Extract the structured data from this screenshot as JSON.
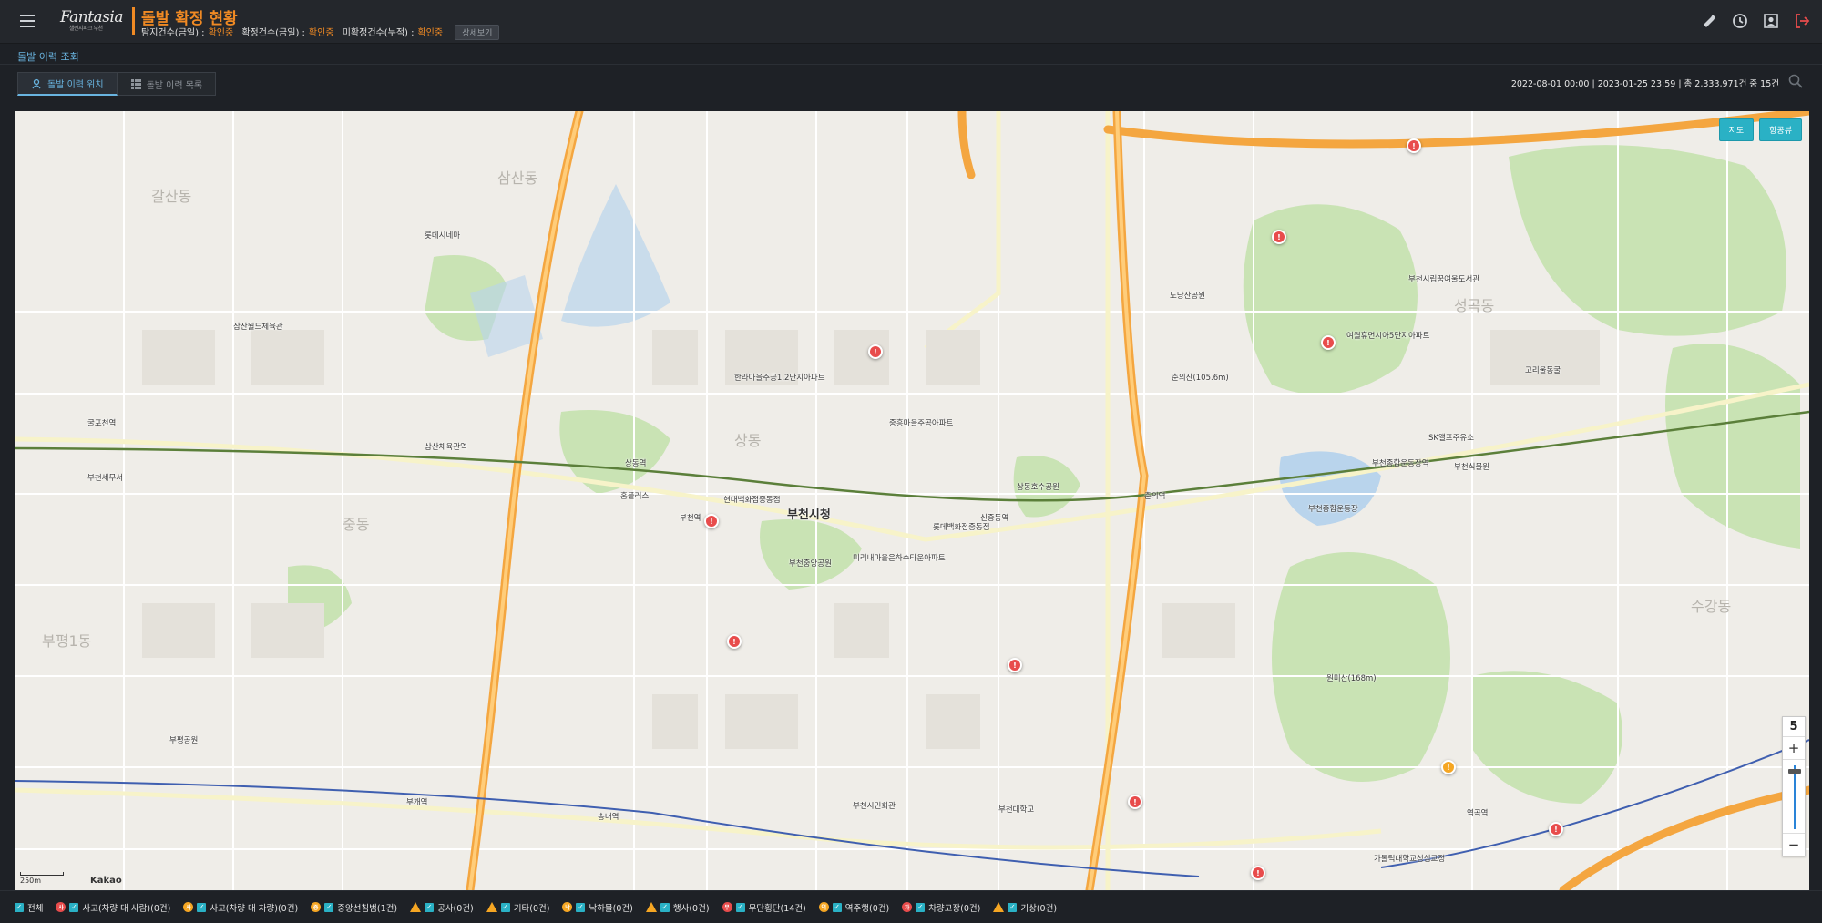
{
  "header": {
    "logo_text": "Fantasia",
    "logo_sub": "챌린지파크 부천",
    "page_title": "돌발 확정 현황",
    "stats": [
      {
        "label": "탐지건수(금일) :",
        "value": "확인중"
      },
      {
        "label": "확정건수(금일) :",
        "value": "확인중"
      },
      {
        "label": "미확정건수(누적) :",
        "value": "확인중"
      }
    ],
    "detail_button": "상세보기"
  },
  "section_label": "돌발 이력 조회",
  "tabs": [
    {
      "label": "돌발 이력 위치",
      "active": true
    },
    {
      "label": "돌발 이력 목록",
      "active": false
    }
  ],
  "range_text": "2022-08-01 00:00 | 2023-01-25 23:59 | 총 2,333,971건 중 15건",
  "map": {
    "buttons": [
      "지도",
      "항공뷰"
    ],
    "zoom_level": "5",
    "zoom_in": "+",
    "zoom_out": "−",
    "scale_label": "250m",
    "attribution": "Kakao",
    "labels": {
      "city_hall": "부천시청",
      "bucheon_station": "부천역",
      "songnae_station": "송내역",
      "bugae_station": "부개역",
      "sosa_station": "부천종합운동장역",
      "sinjung": "신중동역",
      "chunui": "춘의역",
      "sangdong": "상동역",
      "samsan": "삼산체육관역",
      "gulpo": "굴포천역",
      "dong_samsan": "삼산동",
      "dong_sangdong": "상동",
      "dong_jung": "중동",
      "dong_seonggok": "성곡동",
      "dong_sugang": "수강동",
      "dong_bupyeong": "부평1동",
      "dong_gyesan": "갈산동",
      "apt1": "한라마을주공1,2단지아파트",
      "apt2": "미리내마을은하수타운아파트",
      "apt3": "부천중앙공원",
      "apt4": "현대백화점중동점",
      "apt5": "롯데백화점중동점",
      "apt6": "부천종합운동장",
      "apt7": "원미산(168m)",
      "apt8": "춘의산(105.6m)",
      "apt9": "도당산공원",
      "apt10": "부천시립꿈여울도서관",
      "apt11": "여월휴먼시아5단지아파트",
      "apt12": "고리울동굴",
      "apt13": "부천식물원",
      "apt14": "홈플러스",
      "apt15": "롯데시네마",
      "apt16": "부평공원",
      "apt17": "부천세무서",
      "apt18": "삼산월드체육관",
      "apt19": "부천시민회관",
      "apt20": "역곡역",
      "apt21": "가톨릭대학교성심교정",
      "apt22": "SK앨프주유소",
      "apt23": "중흥마을주공아파트",
      "apt24": "상동호수공원",
      "apt25": "부천대학교"
    }
  },
  "legend": [
    {
      "label": "전체",
      "icon": "none",
      "color": ""
    },
    {
      "label": "사고(차량 대 사람)(0건)",
      "icon": "accident-person-icon",
      "color": "#e84c4c"
    },
    {
      "label": "사고(차량 대 차량)(0건)",
      "icon": "accident-car-icon",
      "color": "#f5a623"
    },
    {
      "label": "중앙선침범(1건)",
      "icon": "centerline-icon",
      "color": "#f5a623"
    },
    {
      "label": "공사(0건)",
      "icon": "construction-icon",
      "color": "#f5a623"
    },
    {
      "label": "기타(0건)",
      "icon": "etc-icon",
      "color": "#f5a623"
    },
    {
      "label": "낙하물(0건)",
      "icon": "falling-object-icon",
      "color": "#f5a623"
    },
    {
      "label": "행사(0건)",
      "icon": "event-icon",
      "color": "#f5a623"
    },
    {
      "label": "무단횡단(14건)",
      "icon": "jaywalking-icon",
      "color": "#e84c4c"
    },
    {
      "label": "역주행(0건)",
      "icon": "wrong-way-icon",
      "color": "#f5a623"
    },
    {
      "label": "차량고장(0건)",
      "icon": "breakdown-icon",
      "color": "#e84c4c"
    },
    {
      "label": "기상(0건)",
      "icon": "weather-icon",
      "color": "#f5a623"
    }
  ],
  "markers": [
    {
      "type": "jaywalking",
      "glyph": "!"
    },
    {
      "type": "jaywalking",
      "glyph": "!"
    },
    {
      "type": "jaywalking",
      "glyph": "!"
    },
    {
      "type": "jaywalking",
      "glyph": "!"
    },
    {
      "type": "jaywalking",
      "glyph": "!"
    },
    {
      "type": "jaywalking",
      "glyph": "!"
    },
    {
      "type": "jaywalking",
      "glyph": "!"
    },
    {
      "type": "jaywalking",
      "glyph": "!"
    },
    {
      "type": "jaywalking",
      "glyph": "!"
    },
    {
      "type": "jaywalking",
      "glyph": "!"
    },
    {
      "type": "centerline",
      "glyph": "!"
    }
  ]
}
